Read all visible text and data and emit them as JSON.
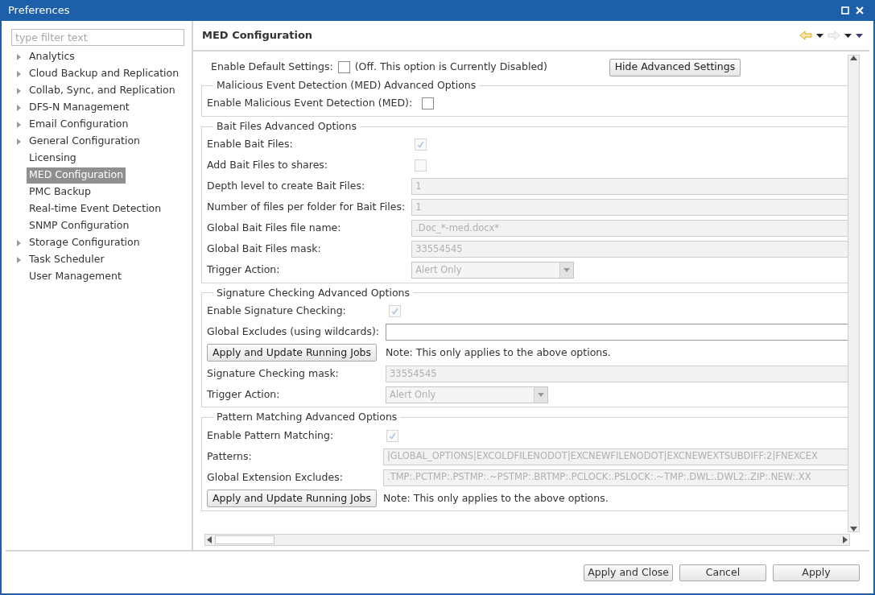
{
  "window": {
    "title": "Preferences"
  },
  "filter": {
    "placeholder": "type filter text"
  },
  "tree": [
    {
      "label": "Analytics",
      "expandable": true,
      "selected": false
    },
    {
      "label": "Cloud Backup and Replication",
      "expandable": true,
      "selected": false
    },
    {
      "label": "Collab, Sync, and Replication",
      "expandable": true,
      "selected": false
    },
    {
      "label": "DFS-N Management",
      "expandable": true,
      "selected": false
    },
    {
      "label": "Email Configuration",
      "expandable": true,
      "selected": false
    },
    {
      "label": "General Configuration",
      "expandable": true,
      "selected": false
    },
    {
      "label": "Licensing",
      "expandable": false,
      "selected": false
    },
    {
      "label": "MED Configuration",
      "expandable": false,
      "selected": true
    },
    {
      "label": "PMC Backup",
      "expandable": false,
      "selected": false
    },
    {
      "label": "Real-time Event Detection",
      "expandable": false,
      "selected": false
    },
    {
      "label": "SNMP Configuration",
      "expandable": false,
      "selected": false
    },
    {
      "label": "Storage Configuration",
      "expandable": true,
      "selected": false
    },
    {
      "label": "Task Scheduler",
      "expandable": true,
      "selected": false
    },
    {
      "label": "User Management",
      "expandable": false,
      "selected": false
    }
  ],
  "page": {
    "title": "MED Configuration"
  },
  "default_settings": {
    "label": "Enable Default Settings:",
    "checked": false,
    "note": "(Off. This option is Currently Disabled)",
    "button": "Hide Advanced Settings"
  },
  "sections": [
    {
      "title": "Malicious Event Detection (MED) Advanced Options",
      "rows": [
        {
          "kind": "checkbox",
          "label": "Enable Malicious Event Detection (MED):",
          "checked": false,
          "disabled": false
        }
      ]
    },
    {
      "title": "Bait Files Advanced Options",
      "rows": [
        {
          "kind": "checkbox",
          "label": "Enable Bait Files:",
          "checked": true,
          "disabled": true
        },
        {
          "kind": "checkbox",
          "label": "Add Bait Files to shares:",
          "checked": false,
          "disabled": true
        },
        {
          "kind": "text",
          "label": "Depth level to create Bait Files:",
          "value": "1",
          "disabled": true
        },
        {
          "kind": "text",
          "label": "Number of files per folder for Bait Files:",
          "value": "1",
          "disabled": true
        },
        {
          "kind": "text",
          "label": "Global Bait Files file name:",
          "value": ".Doc_*-med.docx*",
          "disabled": true
        },
        {
          "kind": "text",
          "label": "Global Bait Files mask:",
          "value": "33554545",
          "disabled": true
        },
        {
          "kind": "dropdown",
          "label": "Trigger Action:",
          "value": "Alert Only",
          "disabled": true
        }
      ]
    },
    {
      "title": "Signature Checking Advanced Options",
      "rows": [
        {
          "kind": "checkbox",
          "label": "Enable Signature Checking:",
          "checked": true,
          "disabled": true
        },
        {
          "kind": "text",
          "label": "Global Excludes (using wildcards):",
          "disabled": false
        },
        {
          "kind": "button_note",
          "button": "Apply and Update Running Jobs",
          "note": "Note: This only applies to the above options."
        },
        {
          "kind": "text",
          "label": "Signature Checking mask:",
          "value": "33554545",
          "disabled": true
        },
        {
          "kind": "dropdown",
          "label": "Trigger Action:",
          "value": "Alert Only",
          "disabled": true
        }
      ]
    },
    {
      "title": "Pattern Matching Advanced Options",
      "rows": [
        {
          "kind": "checkbox",
          "label": "Enable Pattern Matching:",
          "checked": true,
          "disabled": true
        },
        {
          "kind": "text",
          "label": "Patterns:",
          "value": "|GLOBAL_OPTIONS|EXCOLDFILENODOT|EXCNEWFILENODOT|EXCNEWEXTSUBDIFF:2|FNEXCEX",
          "disabled": true
        },
        {
          "kind": "text",
          "label": "Global Extension Excludes:",
          "value": ".TMP:.PCTMP:.PSTMP:.~PSTMP:.BRTMP:.PCLOCK:.PSLOCK:.~TMP:.DWL:.DWL2:.ZIP:.NEW:.XX",
          "disabled": true
        },
        {
          "kind": "button_note",
          "button": "Apply and Update Running Jobs",
          "note": "Note: This only applies to the above options."
        }
      ]
    }
  ],
  "buttons": [
    "Apply and Close",
    "Cancel",
    "Apply"
  ]
}
